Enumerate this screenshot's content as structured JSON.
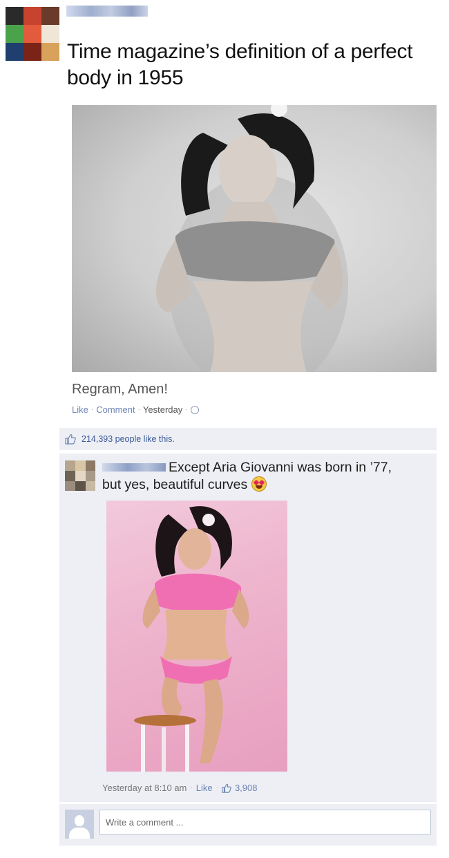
{
  "post": {
    "title": "Time magazine’s definition of a perfect body in 1955",
    "caption": "Regram, Amen!",
    "actions": {
      "like": "Like",
      "comment": "Comment",
      "time": "Yesterday"
    },
    "likes_text": "214,393 people like this."
  },
  "comment": {
    "text": "Except Aria Giovanni was born in ’77, but yes, beautiful curves",
    "time": "Yesterday at 8:10 am",
    "like": "Like",
    "like_count": "3,908"
  },
  "composer": {
    "placeholder": "Write a comment ..."
  },
  "colors": {
    "link": "#6d84b4",
    "panel": "#edeff4",
    "accent_pink": "#e79fbf"
  },
  "icons": [
    "globe-icon",
    "thumbs-up-icon",
    "heart-eyes-emoji-icon",
    "default-avatar-icon"
  ]
}
